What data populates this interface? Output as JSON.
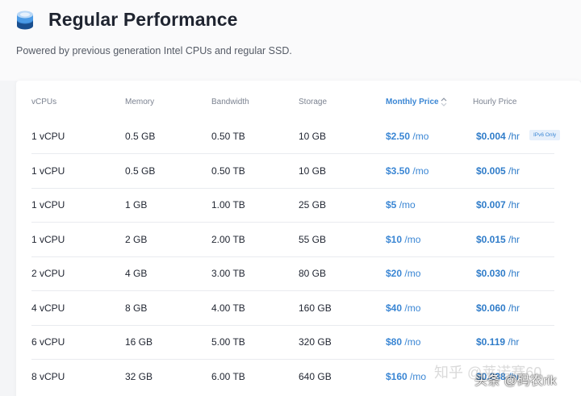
{
  "header": {
    "title": "Regular Performance",
    "subtitle": "Powered by previous generation Intel CPUs and regular SSD."
  },
  "table": {
    "columns": {
      "vcpus": "vCPUs",
      "memory": "Memory",
      "bandwidth": "Bandwidth",
      "storage": "Storage",
      "monthly": "Monthly Price",
      "hourly": "Hourly Price"
    },
    "badge": "IPv6 Only",
    "rows": [
      {
        "vcpu": "1 vCPU",
        "memory": "0.5 GB",
        "bandwidth": "0.50 TB",
        "storage": "10 GB",
        "monthly": "$2.50",
        "monthly_unit": "/mo",
        "hourly": "$0.004",
        "hourly_unit": "/hr"
      },
      {
        "vcpu": "1 vCPU",
        "memory": "0.5 GB",
        "bandwidth": "0.50 TB",
        "storage": "10 GB",
        "monthly": "$3.50",
        "monthly_unit": "/mo",
        "hourly": "$0.005",
        "hourly_unit": "/hr"
      },
      {
        "vcpu": "1 vCPU",
        "memory": "1 GB",
        "bandwidth": "1.00 TB",
        "storage": "25 GB",
        "monthly": "$5",
        "monthly_unit": "/mo",
        "hourly": "$0.007",
        "hourly_unit": "/hr"
      },
      {
        "vcpu": "1 vCPU",
        "memory": "2 GB",
        "bandwidth": "2.00 TB",
        "storage": "55 GB",
        "monthly": "$10",
        "monthly_unit": "/mo",
        "hourly": "$0.015",
        "hourly_unit": "/hr"
      },
      {
        "vcpu": "2 vCPU",
        "memory": "4 GB",
        "bandwidth": "3.00 TB",
        "storage": "80 GB",
        "monthly": "$20",
        "monthly_unit": "/mo",
        "hourly": "$0.030",
        "hourly_unit": "/hr"
      },
      {
        "vcpu": "4 vCPU",
        "memory": "8 GB",
        "bandwidth": "4.00 TB",
        "storage": "160 GB",
        "monthly": "$40",
        "monthly_unit": "/mo",
        "hourly": "$0.060",
        "hourly_unit": "/hr"
      },
      {
        "vcpu": "6 vCPU",
        "memory": "16 GB",
        "bandwidth": "5.00 TB",
        "storage": "320 GB",
        "monthly": "$80",
        "monthly_unit": "/mo",
        "hourly": "$0.119",
        "hourly_unit": "/hr"
      },
      {
        "vcpu": "8 vCPU",
        "memory": "32 GB",
        "bandwidth": "6.00 TB",
        "storage": "640 GB",
        "monthly": "$160",
        "monthly_unit": "/mo",
        "hourly": "$0.238",
        "hourly_unit": "/hr"
      }
    ]
  },
  "watermark": {
    "line1": "知乎 @莱诺赛60",
    "line2": "头条 @码农rik"
  },
  "colors": {
    "accent": "#3a86d4",
    "text": "#222733",
    "muted": "#7b8290"
  },
  "icons": {
    "logo": "server-stack-icon",
    "sort": "sort-arrows-icon"
  }
}
